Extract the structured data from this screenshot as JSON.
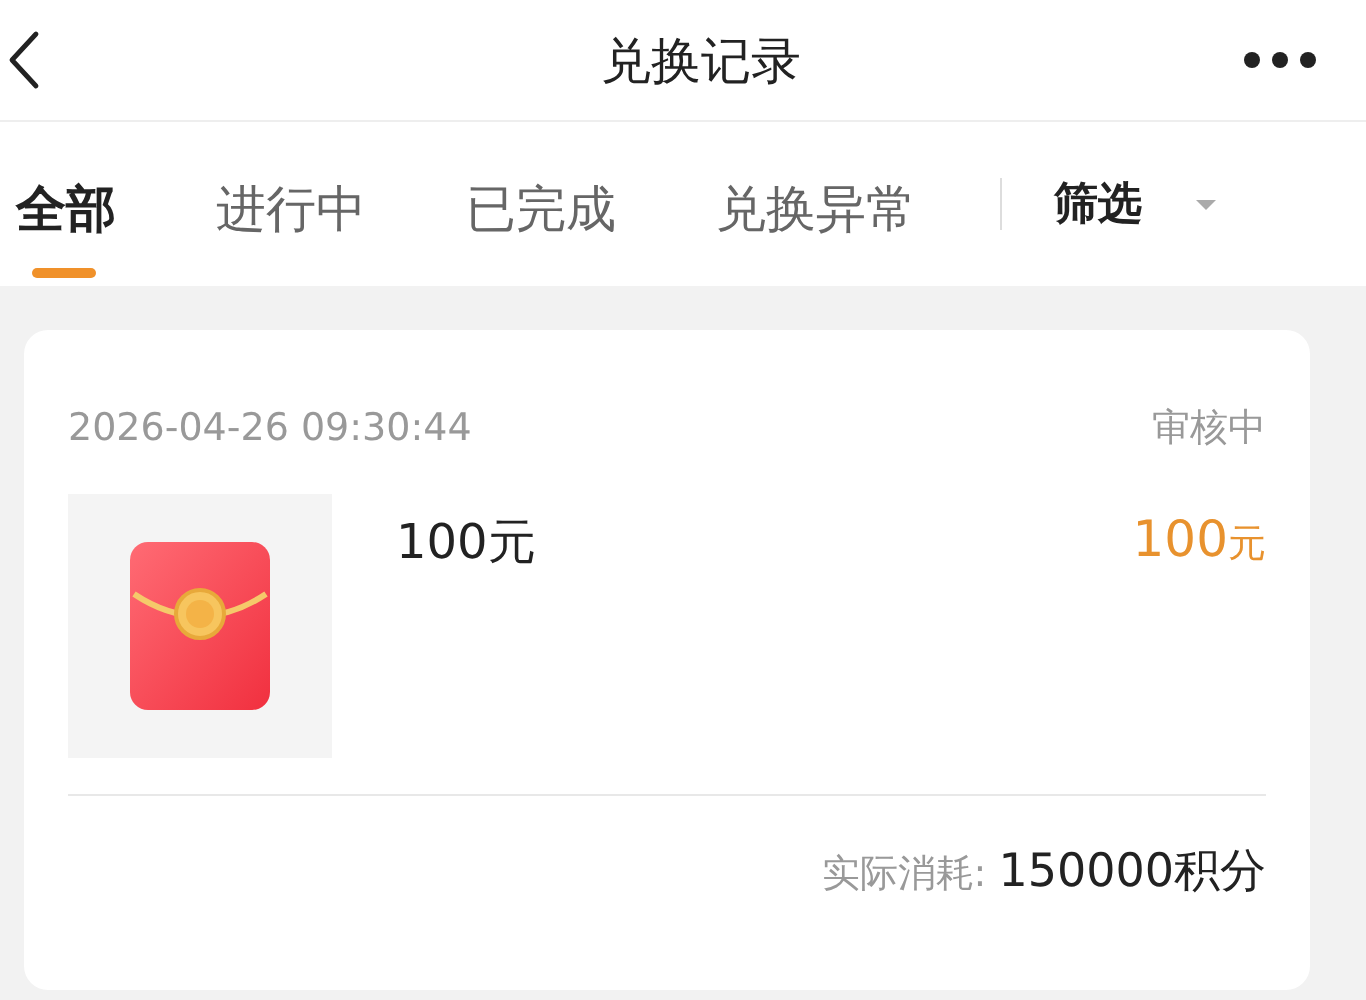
{
  "header": {
    "title": "兑换记录"
  },
  "tabs": [
    {
      "label": "全部",
      "selected": true
    },
    {
      "label": "进行中",
      "selected": false
    },
    {
      "label": "已完成",
      "selected": false
    },
    {
      "label": "兑换异常",
      "selected": false
    }
  ],
  "filter": {
    "label": "筛选"
  },
  "records": [
    {
      "time": "2026-04-26 09:30:44",
      "status": "审核中",
      "name": "100元",
      "price": {
        "amount": "100",
        "unit": "元"
      },
      "cost_label": "实际消耗:",
      "cost": "150000积分"
    }
  ]
}
